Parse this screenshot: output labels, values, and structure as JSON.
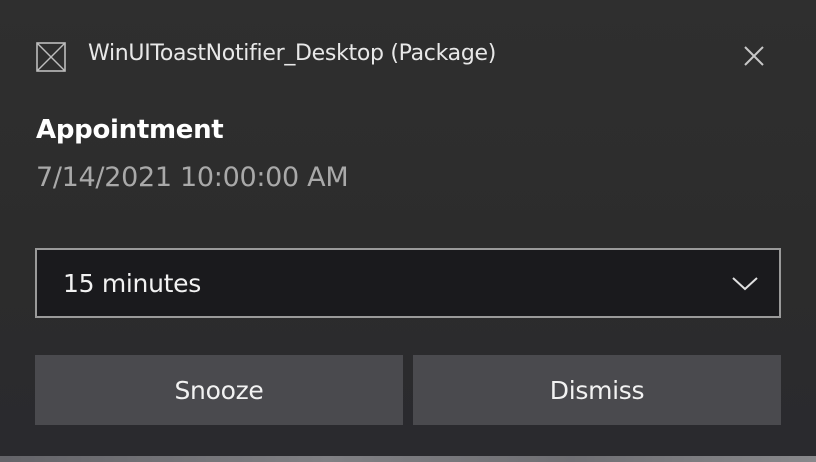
{
  "header": {
    "app_name": "WinUIToastNotifier_Desktop (Package)",
    "app_icon": "placeholder-image-icon",
    "close_icon": "close-icon"
  },
  "content": {
    "title": "Appointment",
    "subtitle": "7/14/2021 10:00:00 AM"
  },
  "snooze_select": {
    "value": "15 minutes",
    "icon": "chevron-down-icon"
  },
  "actions": {
    "snooze_label": "Snooze",
    "dismiss_label": "Dismiss"
  },
  "colors": {
    "background": "#2c2c2c",
    "select_background": "#1a1a1d",
    "select_border": "#9a9a9a",
    "button_background": "#4a4a4e",
    "title_text": "#ffffff",
    "subtitle_text": "#a9a9a9"
  }
}
